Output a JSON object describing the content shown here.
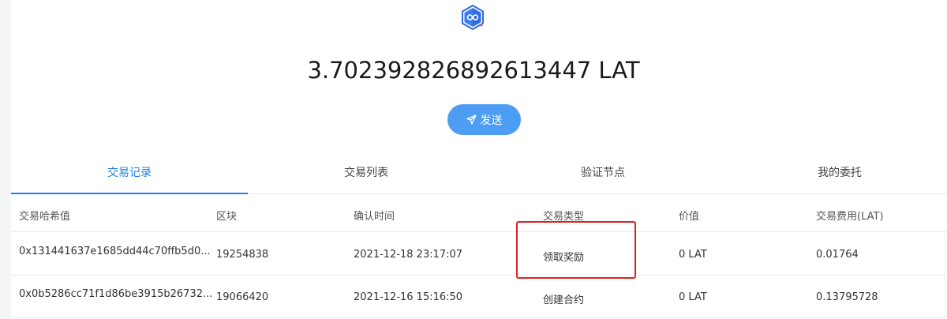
{
  "wallet": {
    "balance": "3.702392826892613447 LAT",
    "send_label": "发送",
    "logo_icon": "wallet-logo-icon"
  },
  "tabs": [
    {
      "label": "交易记录",
      "active": true
    },
    {
      "label": "交易列表",
      "active": false
    },
    {
      "label": "验证节点",
      "active": false
    },
    {
      "label": "我的委托",
      "active": false
    }
  ],
  "table": {
    "columns": [
      "交易哈希值",
      "区块",
      "确认时间",
      "交易类型",
      "价值",
      "交易费用(LAT)"
    ],
    "rows": [
      [
        "0x131441637e1685dd44c70ffb5d0...",
        "19254838",
        "2021-12-18 23:17:07",
        "领取奖励",
        "0 LAT",
        "0.01764"
      ],
      [
        "0x0b5286cc71f1d86be3915b26732...",
        "19066420",
        "2021-12-16 15:16:50",
        "创建合约",
        "0 LAT",
        "0.13795728"
      ]
    ]
  },
  "colors": {
    "accent": "#1e7fe6",
    "send_button": "#4d9df4",
    "highlight_box": "#e02020"
  }
}
